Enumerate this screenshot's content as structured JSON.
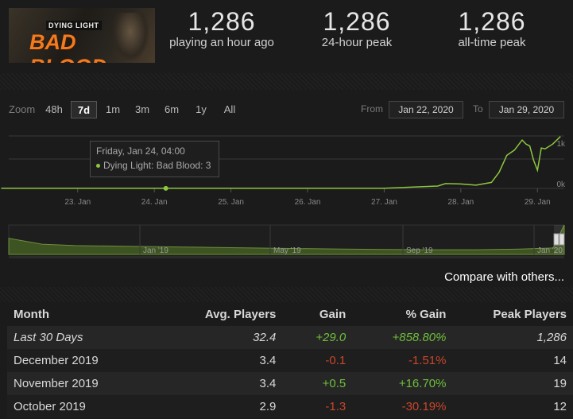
{
  "game": {
    "logo_small": "DYING LIGHT",
    "logo_big": "BAD BLOOD"
  },
  "stats": [
    {
      "value": "1,286",
      "label": "playing an hour ago"
    },
    {
      "value": "1,286",
      "label": "24-hour peak"
    },
    {
      "value": "1,286",
      "label": "all-time peak"
    }
  ],
  "controls": {
    "zoom_label": "Zoom",
    "zoom_options": [
      "48h",
      "7d",
      "1m",
      "3m",
      "6m",
      "1y",
      "All"
    ],
    "zoom_selected": "7d",
    "from_label": "From",
    "from_date": "Jan 22, 2020",
    "to_label": "To",
    "to_date": "Jan 29, 2020"
  },
  "tooltip": {
    "title": "Friday, Jan 24, 04:00",
    "series": "Dying Light: Bad Blood: 3"
  },
  "chart_data": [
    {
      "type": "line",
      "series": [
        {
          "name": "Dying Light: Bad Blood",
          "color": "#8dc63f",
          "x": [
            22.0,
            23.0,
            24.0,
            25.0,
            26.0,
            27.0,
            27.7,
            27.8,
            28.0,
            28.2,
            28.4,
            28.5,
            28.6,
            28.7,
            28.8,
            28.85,
            28.9,
            28.95,
            29.0,
            29.05,
            29.1,
            29.2,
            29.3
          ],
          "y": [
            3,
            3,
            3,
            3,
            4,
            4,
            60,
            120,
            110,
            80,
            150,
            400,
            820,
            950,
            1200,
            1100,
            1050,
            700,
            450,
            1000,
            980,
            1100,
            1286
          ]
        }
      ],
      "x_ticks": [
        "23. Jan",
        "24. Jan",
        "25. Jan",
        "26. Jan",
        "27. Jan",
        "28. Jan",
        "29. Jan"
      ],
      "y_ticks": [
        "0k",
        "1k"
      ],
      "ylim": [
        0,
        1300
      ],
      "grid": true
    },
    {
      "type": "area",
      "series": [
        {
          "color": "#5a7a30",
          "x": [
            0,
            0.3,
            0.6,
            1.0,
            1.4,
            1.8,
            2.2,
            2.6,
            3.0,
            3.4,
            3.8,
            4.2,
            4.6,
            4.9,
            5.0
          ],
          "y": [
            0.55,
            0.35,
            0.3,
            0.28,
            0.26,
            0.24,
            0.22,
            0.2,
            0.18,
            0.17,
            0.16,
            0.16,
            0.18,
            0.22,
            1.0
          ]
        }
      ],
      "x_ticks": [
        "Jan '19",
        "May '19",
        "Sep '19",
        "Jan '20"
      ]
    }
  ],
  "compare_link": "Compare with others...",
  "table": {
    "headers": [
      "Month",
      "Avg. Players",
      "Gain",
      "% Gain",
      "Peak Players"
    ],
    "rows": [
      {
        "month": "Last 30 Days",
        "avg": "32.4",
        "gain": "+29.0",
        "pct": "+858.80%",
        "peak": "1,286",
        "italic": true
      },
      {
        "month": "December 2019",
        "avg": "3.4",
        "gain": "-0.1",
        "pct": "-1.51%",
        "peak": "14"
      },
      {
        "month": "November 2019",
        "avg": "3.4",
        "gain": "+0.5",
        "pct": "+16.70%",
        "peak": "19"
      },
      {
        "month": "October 2019",
        "avg": "2.9",
        "gain": "-1.3",
        "pct": "-30.19%",
        "peak": "12"
      }
    ]
  }
}
